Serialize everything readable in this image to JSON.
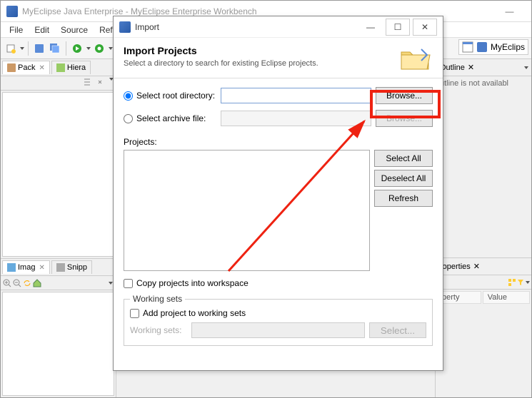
{
  "window": {
    "title": "MyEclipse Java Enterprise - MyEclipse Enterprise Workbench"
  },
  "menu": [
    "File",
    "Edit",
    "Source",
    "Refacto"
  ],
  "perspective": {
    "label": "MyEclips"
  },
  "views": {
    "left_top": {
      "tab1": "Pack",
      "tab2": "Hiera"
    },
    "left_bottom": {
      "tab1": "Imag",
      "tab2": "Snipp"
    },
    "right_outline": {
      "title": "Outline",
      "msg": "utline is not availabl"
    },
    "right_properties": {
      "title": "roperties",
      "col1": "perty",
      "col2": "Value"
    }
  },
  "dialog": {
    "title": "Import",
    "heading": "Import Projects",
    "subtitle": "Select a directory to search for existing Eclipse projects.",
    "root_radio": "Select root directory:",
    "archive_radio": "Select archive file:",
    "root_value": "",
    "browse": "Browse...",
    "projects_label": "Projects:",
    "select_all": "Select All",
    "deselect_all": "Deselect All",
    "refresh": "Refresh",
    "copy_checkbox": "Copy projects into workspace",
    "working_sets_legend": "Working sets",
    "add_ws_checkbox": "Add project to working sets",
    "ws_label": "Working sets:",
    "select_btn": "Select..."
  }
}
